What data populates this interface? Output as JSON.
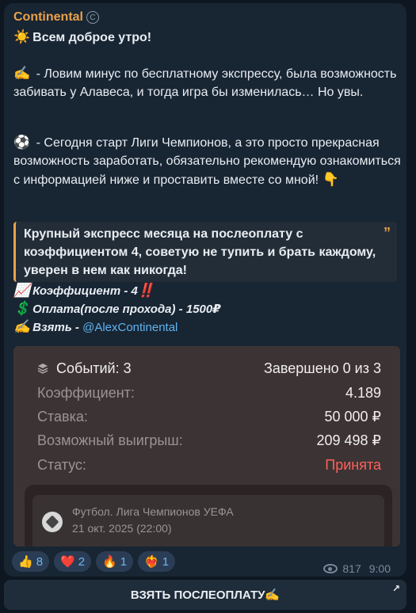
{
  "post": {
    "channel_name": "Continental",
    "greeting": "Всем доброе утро!",
    "para1": " - Ловим минус по бесплатному экспрессу, была возможность забивать у Алавеса, и тогда игра бы изменилась… Но увы.",
    "para2": " - Сегодня старт Лиги Чемпионов, а это просто прекрасная возможность заработать, обязательно рекомендую ознакомиться с информацией ниже и проставить вместе со мной! ",
    "quote": "Крупный экспресс месяца на послеоплату с коэффициентом 4, советую не тупить и брать каждому, уверен в нем как никогда!",
    "coef_line": "Коэффициент - 4",
    "pay_line": "Оплата(после прохода) - 1500₽",
    "take_label": "Взять",
    "take_dash": " - ",
    "take_link": "@AlexContinental"
  },
  "bet_card": {
    "events": "Событий: 3",
    "completed": "Завершено 0 из 3",
    "coef_label": "Коэффициент:",
    "coef_value": "4.189",
    "stake_label": "Ставка:",
    "stake_value": "50 000 ₽",
    "win_label": "Возможный выигрыш:",
    "win_value": "209 498 ₽",
    "status_label": "Статус:",
    "status_value": "Принята",
    "match_league": "Футбол. Лига Чемпионов УЕФА",
    "match_date": "21 окт. 2025 (22:00)"
  },
  "reactions": [
    {
      "emoji": "👍",
      "count": "8"
    },
    {
      "emoji": "❤️",
      "count": "2"
    },
    {
      "emoji": "🔥",
      "count": "1"
    },
    {
      "emoji": "❤️‍🔥",
      "count": "1"
    }
  ],
  "meta": {
    "views": "817",
    "time": "9:00"
  },
  "cta": {
    "label": "ВЗЯТЬ ПОСЛЕОПЛАТУ✍️"
  },
  "colors": {
    "accent": "#e9a14a",
    "link": "#5fb4f0",
    "status": "#ff5f5a"
  }
}
